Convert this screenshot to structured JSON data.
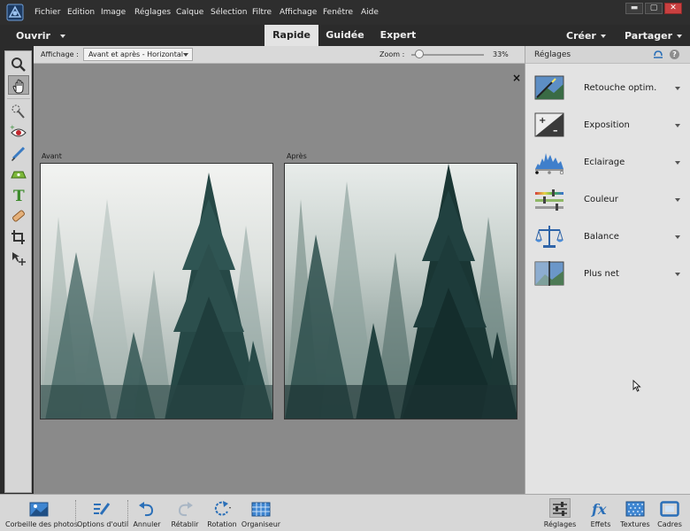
{
  "menubar": {
    "items": [
      "Fichier",
      "Edition",
      "Image",
      "Réglages",
      "Calque",
      "Sélection",
      "Filtre",
      "Affichage",
      "Fenêtre",
      "Aide"
    ]
  },
  "modebar": {
    "open_label": "Ouvrir",
    "tabs": [
      "Rapide",
      "Guidée",
      "Expert"
    ],
    "active_tab": "Rapide",
    "create_label": "Créer",
    "share_label": "Partager"
  },
  "options": {
    "view_label": "Affichage :",
    "view_value": "Avant et après - Horizontal",
    "zoom_label": "Zoom :",
    "zoom_value": "33%",
    "zoom_fraction": 0.05
  },
  "canvas": {
    "close_glyph": "×",
    "before_label": "Avant",
    "after_label": "Après"
  },
  "panel": {
    "title": "Réglages",
    "adjustments": [
      {
        "label": "Retouche optim.",
        "icon": "smart-fix-icon"
      },
      {
        "label": "Exposition",
        "icon": "exposure-icon"
      },
      {
        "label": "Eclairage",
        "icon": "levels-histogram-icon"
      },
      {
        "label": "Couleur",
        "icon": "color-sliders-icon"
      },
      {
        "label": "Balance",
        "icon": "balance-scale-icon"
      },
      {
        "label": "Plus net",
        "icon": "sharpen-icon"
      }
    ]
  },
  "bottombar": {
    "left": [
      {
        "label": "Corbeille des photos",
        "icon": "photo-bin-icon"
      },
      {
        "label": "Options d'outil",
        "icon": "tool-options-icon"
      },
      {
        "label": "Annuler",
        "icon": "undo-icon"
      },
      {
        "label": "Rétablir",
        "icon": "redo-icon"
      },
      {
        "label": "Rotation",
        "icon": "rotate-icon"
      },
      {
        "label": "Organiseur",
        "icon": "organizer-icon"
      }
    ],
    "right": [
      {
        "label": "Réglages",
        "icon": "adjustments-icon"
      },
      {
        "label": "Effets",
        "icon": "effects-fx-icon"
      },
      {
        "label": "Textures",
        "icon": "textures-icon"
      },
      {
        "label": "Cadres",
        "icon": "frames-icon"
      }
    ]
  },
  "colors": {
    "menubar_bg": "#2e2e2e",
    "canvas_bg": "#8a8a8a",
    "panel_bg": "#e3e3e3",
    "active_tab_bg": "#e3e3e3",
    "accent_blue": "#2a6fb8"
  }
}
